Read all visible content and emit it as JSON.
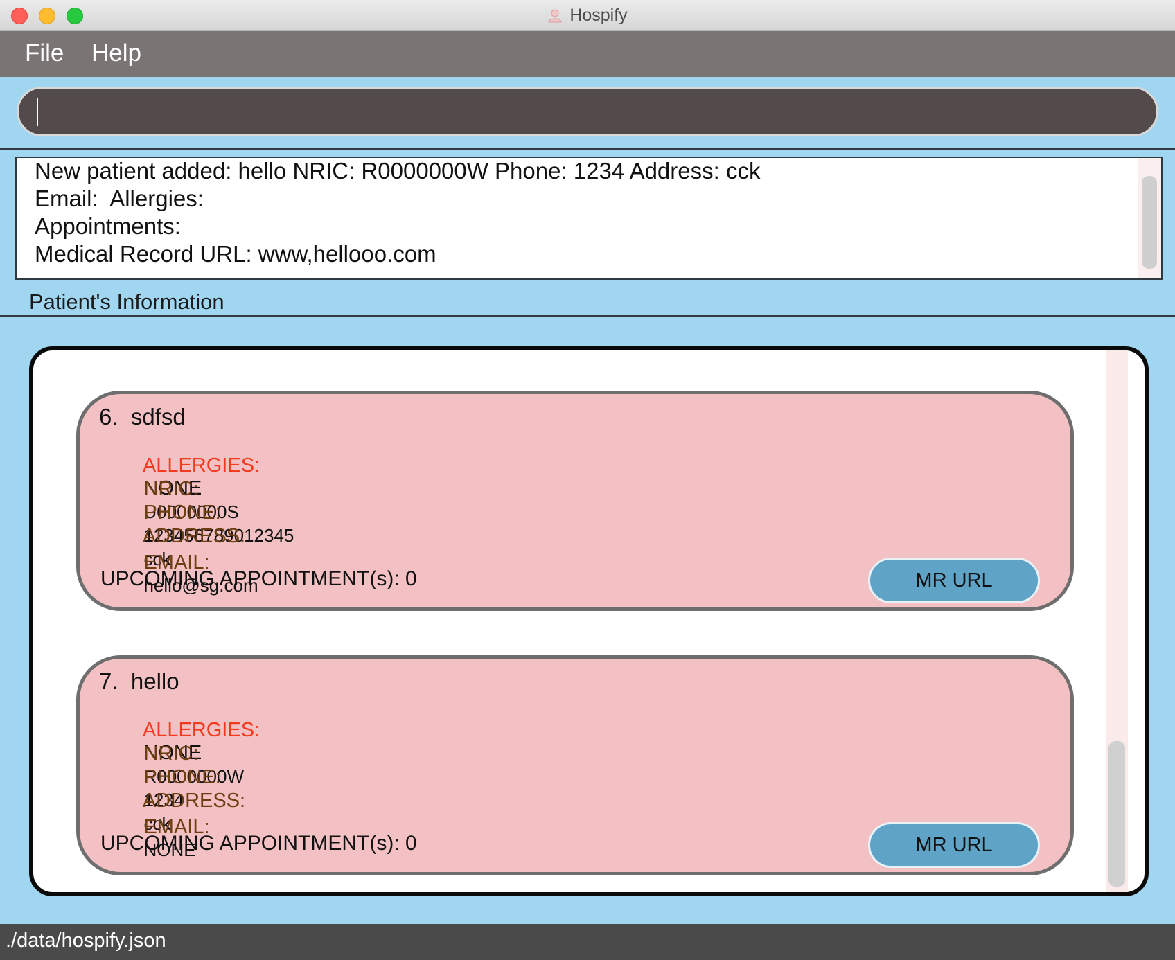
{
  "window": {
    "title": "Hospify",
    "icon": "hospital-user-icon"
  },
  "menu": {
    "items": [
      {
        "label": "File"
      },
      {
        "label": "Help"
      }
    ]
  },
  "command_box": {
    "value": ""
  },
  "result_display": {
    "lines": [
      "New patient added: hello NRIC: R0000000W Phone: 1234 Address: cck",
      "Email:  Allergies: ",
      "Appointments: ",
      "Medical Record URL: www,hellooo.com"
    ]
  },
  "section": {
    "title": "Patient's Information"
  },
  "patients": [
    {
      "header": "6.  sdfsd",
      "allergies_label": "ALLERGIES:",
      "allergies": "NONE",
      "nric_label": "NRIC:",
      "nric": "U0000000S",
      "phone_label": "PHONE:",
      "phone": "123456789012345",
      "address_label": "ADDRESS:",
      "address": "cck",
      "email_label": "EMAIL:",
      "email": "hello@sg.com",
      "appointments": "UPCOMING APPOINTMENT(s): 0",
      "mr_button": "MR URL"
    },
    {
      "header": "7.  hello",
      "allergies_label": "ALLERGIES:",
      "allergies": "NONE",
      "nric_label": "NRIC:",
      "nric": "R0000000W",
      "phone_label": "PHONE:",
      "phone": "1234",
      "address_label": "ADDRESS:",
      "address": "cck",
      "email_label": "EMAIL:",
      "email": "NONE",
      "appointments": "UPCOMING APPOINTMENT(s): 0",
      "mr_button": "MR URL"
    }
  ],
  "status_bar": {
    "path": "./data/hospify.json"
  },
  "colors": {
    "background": "#a1d6f1",
    "menubar": "#7a7474",
    "command_box": "#524a4b",
    "card": "#f3c1c3",
    "allergy_label": "#f23a1e",
    "field_label": "#6b3f12",
    "button": "#5fa4c6",
    "statusbar": "#4a4a4a"
  }
}
